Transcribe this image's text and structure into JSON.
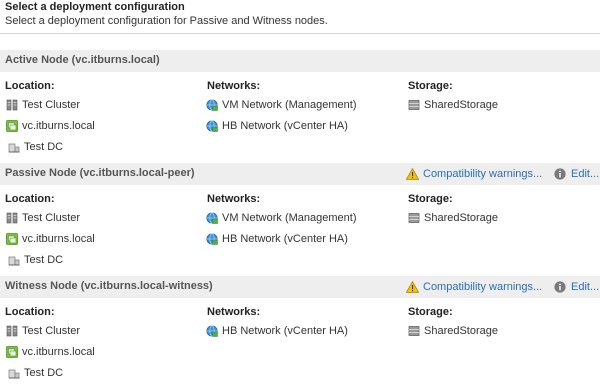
{
  "header": {
    "title": "Select a deployment configuration",
    "subtitle": "Select a deployment configuration for Passive and Witness nodes."
  },
  "columns": {
    "location": "Location:",
    "networks": "Networks:",
    "storage": "Storage:"
  },
  "warning_link": "Compatibility warnings...",
  "edit_link": "Edit...",
  "nodes": [
    {
      "title": "Active Node (vc.itburns.local)",
      "location": [
        "Test Cluster",
        "vc.itburns.local",
        "Test DC"
      ],
      "networks": [
        "VM Network (Management)",
        "HB Network (vCenter HA)"
      ],
      "storage": [
        "SharedStorage"
      ]
    },
    {
      "title": "Passive Node (vc.itburns.local-peer)",
      "location": [
        "Test Cluster",
        "vc.itburns.local",
        "Test DC"
      ],
      "networks": [
        "VM Network (Management)",
        "HB Network (vCenter HA)"
      ],
      "storage": [
        "SharedStorage"
      ]
    },
    {
      "title": "Witness Node (vc.itburns.local-witness)",
      "location": [
        "Test Cluster",
        "vc.itburns.local",
        "Test DC"
      ],
      "networks": [
        "HB Network (vCenter HA)"
      ],
      "storage": [
        "SharedStorage"
      ]
    }
  ],
  "icons": {
    "cluster": "cluster-icon",
    "vm": "vm-icon",
    "datacenter": "datacenter-icon",
    "network": "network-icon",
    "datastore": "datastore-icon",
    "warning": "warning-icon",
    "info": "info-icon"
  },
  "colors": {
    "link": "#2a6fb6",
    "section_header_bg": "#eeeeee",
    "warning": "#f5c400"
  }
}
